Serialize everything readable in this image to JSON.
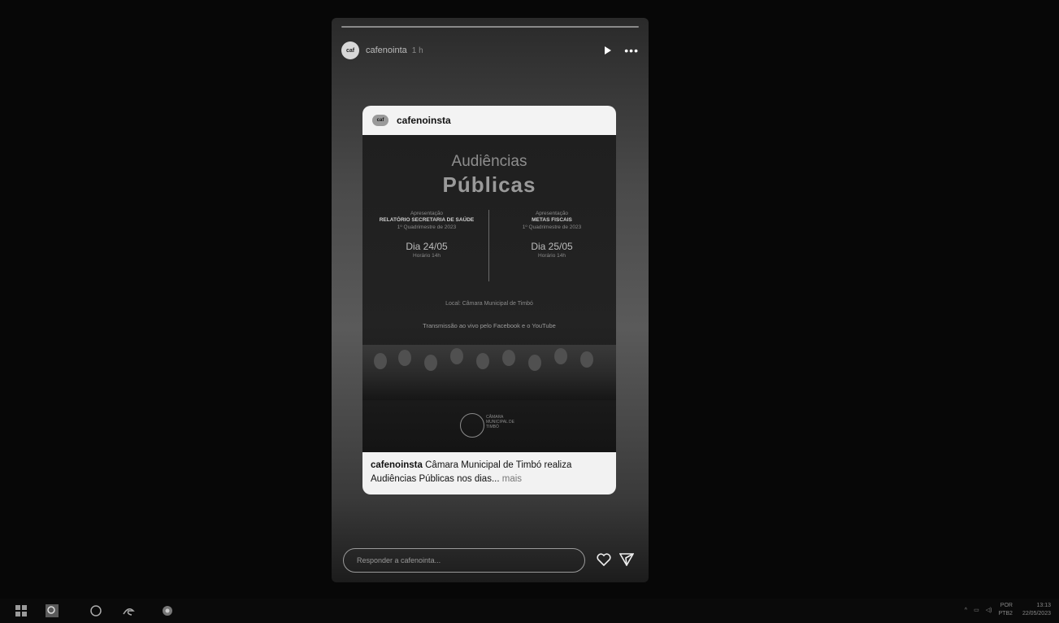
{
  "story": {
    "username": "cafenointa",
    "time": "1 h",
    "reply_placeholder": "Responder a cafenointa..."
  },
  "post": {
    "username": "cafenoinsta",
    "poster": {
      "title_line1": "Audiências",
      "title_line2": "Públicas",
      "left": {
        "label": "Apresentação",
        "subject": "RELATÓRIO SECRETARIA DE SAÚDE",
        "period": "1º Quadrimestre de 2023",
        "day": "Dia 24/05",
        "hour": "Horário 14h"
      },
      "right": {
        "label": "Apresentação",
        "subject": "METAS FISCAIS",
        "period": "1º Quadrimestre de 2023",
        "day": "Dia 25/05",
        "hour": "Horário 14h"
      },
      "local": "Local: Câmara Municipal de Timbó",
      "transmission": "Transmissão ao vivo pelo Facebook  e o YouTube",
      "logo_text": "CÂMARA MUNICIPAL DE TIMBÓ"
    },
    "caption": {
      "user": "cafenoinsta",
      "text": " Câmara Municipal de Timbó realiza Audiências Públicas nos dias...",
      "more": " mais"
    }
  },
  "taskbar": {
    "tray_lang": "POR",
    "tray_layout": "PTB2",
    "time": "13:13",
    "date": "22/05/2023"
  },
  "icons": [
    "play-icon",
    "more-icon",
    "heart-icon",
    "send-icon",
    "start-icon",
    "search-icon",
    "task-view-icon",
    "edge-icon",
    "chrome-icon",
    "chevron-up-icon",
    "network-icon",
    "volume-icon"
  ]
}
